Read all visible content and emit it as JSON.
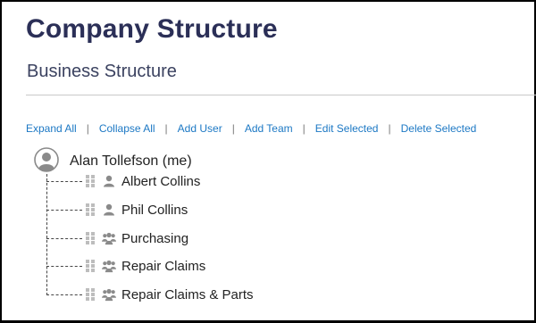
{
  "page": {
    "title": "Company Structure",
    "section_title": "Business Structure"
  },
  "toolbar": {
    "expand_all": "Expand All",
    "collapse_all": "Collapse All",
    "add_user": "Add User",
    "add_team": "Add Team",
    "edit_selected": "Edit Selected",
    "delete_selected": "Delete Selected",
    "separator": "|"
  },
  "tree": {
    "root": {
      "label": "Alan Tollefson (me)",
      "icon": "user-avatar-icon"
    },
    "children": [
      {
        "label": "Albert Collins",
        "icon": "user-icon",
        "type": "user"
      },
      {
        "label": "Phil Collins",
        "icon": "user-icon",
        "type": "user"
      },
      {
        "label": "Purchasing",
        "icon": "team-icon",
        "type": "team"
      },
      {
        "label": "Repair Claims",
        "icon": "team-icon",
        "type": "team"
      },
      {
        "label": "Repair Claims & Parts",
        "icon": "team-icon",
        "type": "team"
      }
    ]
  },
  "colors": {
    "title": "#2b2f57",
    "link": "#1c78c4",
    "icon_gray": "#8a8a8a"
  }
}
